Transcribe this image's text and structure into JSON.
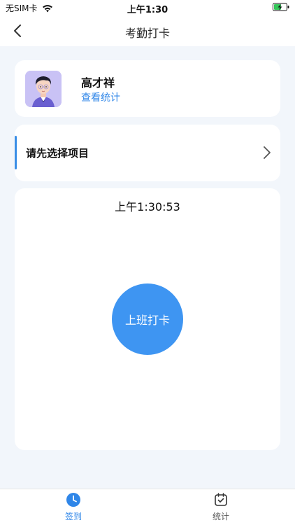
{
  "status_bar": {
    "carrier": "无SIM卡",
    "time": "上午1:30",
    "wifi_icon": "wifi-icon",
    "battery_icon": "battery-charging-icon"
  },
  "nav": {
    "title": "考勤打卡",
    "back_icon": "chevron-left-icon"
  },
  "profile": {
    "name": "高才祥",
    "link_label": "查看统计",
    "avatar_icon": "avatar-illustration"
  },
  "project": {
    "prompt": "请先选择项目",
    "chevron_icon": "chevron-right-icon"
  },
  "checkin": {
    "clock": "上午1:30:53",
    "button_label": "上班打卡"
  },
  "tabs": [
    {
      "label": "签到",
      "icon": "clock-icon",
      "active": true
    },
    {
      "label": "统计",
      "icon": "calendar-check-icon",
      "active": false
    }
  ],
  "colors": {
    "accent": "#3e95f2",
    "link": "#2f86e8",
    "background": "#f2f6fb",
    "card": "#ffffff"
  }
}
